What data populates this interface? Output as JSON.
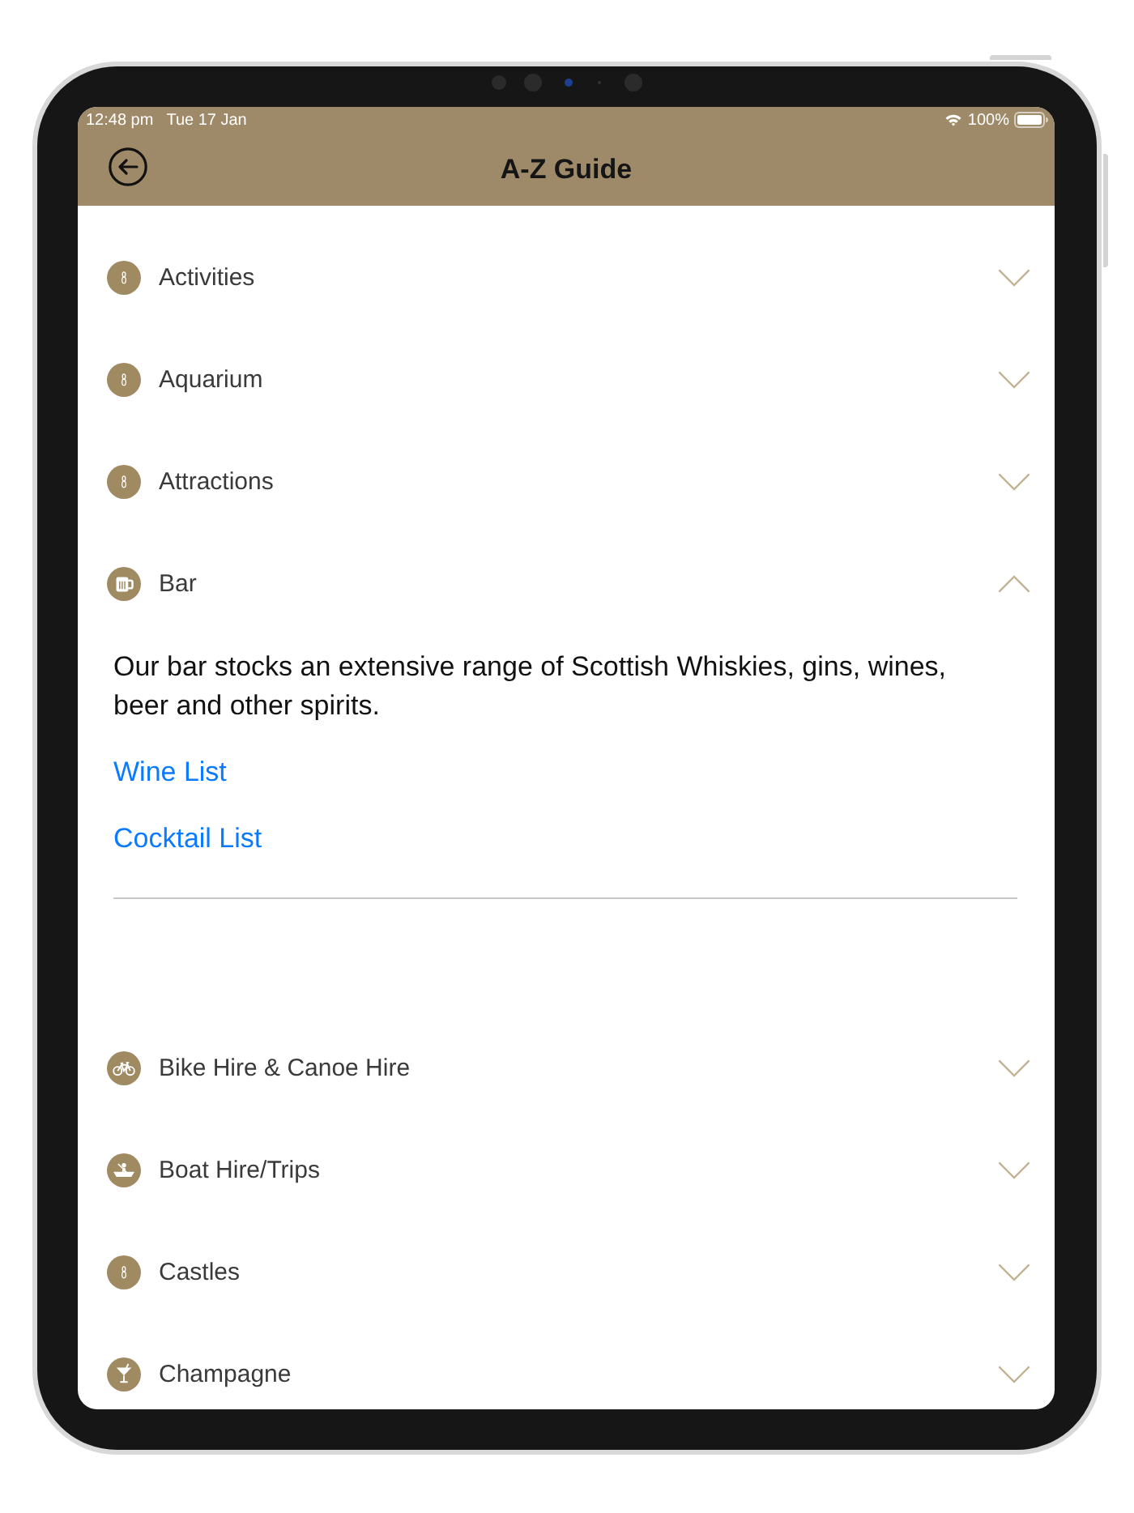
{
  "status_bar": {
    "time": "12:48 pm",
    "date": "Tue 17 Jan",
    "battery": "100%"
  },
  "header": {
    "title": "A-Z Guide"
  },
  "items": [
    {
      "label": "Activities",
      "kind": "generic",
      "expanded": false
    },
    {
      "label": "Aquarium",
      "kind": "generic",
      "expanded": false
    },
    {
      "label": "Attractions",
      "kind": "generic",
      "expanded": false
    },
    {
      "label": "Bar",
      "kind": "beer",
      "expanded": true,
      "description": "Our bar stocks an extensive range of Scottish Whiskies, gins, wines, beer and other spirits.",
      "links": [
        "Wine List",
        "Cocktail List"
      ]
    },
    {
      "label": "Bike Hire & Canoe Hire",
      "kind": "bike",
      "expanded": false
    },
    {
      "label": "Boat Hire/Trips",
      "kind": "boat",
      "expanded": false
    },
    {
      "label": "Castles",
      "kind": "generic",
      "expanded": false
    },
    {
      "label": "Champagne",
      "kind": "cocktail",
      "expanded": false
    }
  ]
}
